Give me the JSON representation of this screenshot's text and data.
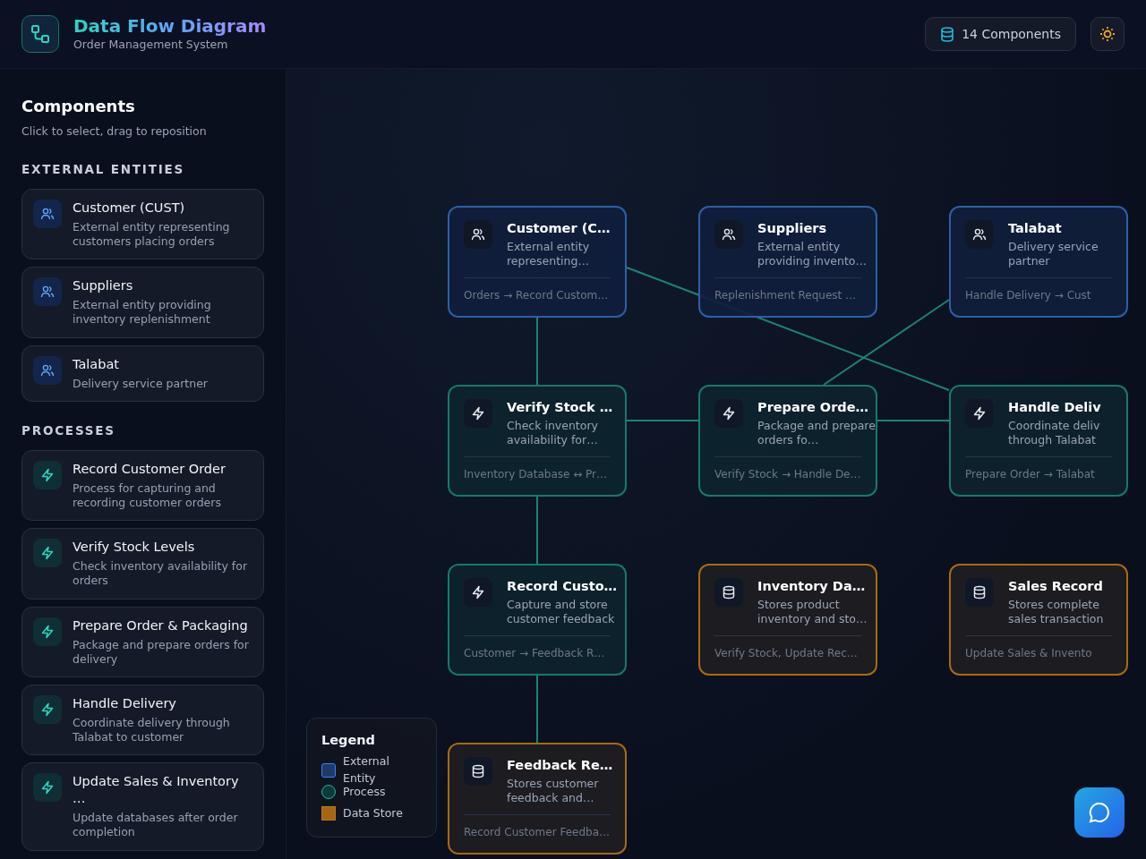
{
  "header": {
    "title": "Data Flow Diagram",
    "subtitle": "Order Management System",
    "component_count": "14 Components"
  },
  "sidebar": {
    "title": "Components",
    "hint": "Click to select, drag to reposition",
    "sections": [
      {
        "heading": "EXTERNAL ENTITIES",
        "kind": "external",
        "items": [
          {
            "title": "Customer (CUST)",
            "description": "External entity representing customers placing orders"
          },
          {
            "title": "Suppliers",
            "description": "External entity providing inventory replenishment"
          },
          {
            "title": "Talabat",
            "description": "Delivery service partner"
          }
        ]
      },
      {
        "heading": "PROCESSES",
        "kind": "process",
        "items": [
          {
            "title": "Record Customer Order",
            "description": "Process for capturing and recording customer orders"
          },
          {
            "title": "Verify Stock Levels",
            "description": "Check inventory availability for orders"
          },
          {
            "title": "Prepare Order & Packaging",
            "description": "Package and prepare orders for delivery"
          },
          {
            "title": "Handle Delivery",
            "description": "Coordinate delivery through Talabat to customer"
          },
          {
            "title": "Update Sales & Inventory …",
            "description": "Update databases after order completion"
          }
        ]
      }
    ]
  },
  "legend": {
    "title": "Legend",
    "items": [
      {
        "label": "External Entity",
        "kind": "external"
      },
      {
        "label": "Process",
        "kind": "process"
      },
      {
        "label": "Data Store",
        "kind": "store"
      }
    ]
  },
  "canvas": {
    "nodes": [
      {
        "kind": "external",
        "title": "Customer (C…",
        "description": "External entity representing…",
        "flows": "Orders → Record Custom…"
      },
      {
        "kind": "external",
        "title": "Suppliers",
        "description": "External entity providing invento…",
        "flows": "Replenishment Request …"
      },
      {
        "kind": "external",
        "title": "Talabat",
        "description": "Delivery service partner",
        "flows": "Handle Delivery → Cust"
      },
      {
        "kind": "process",
        "title": "Verify Stock …",
        "description": "Check inventory availability for…",
        "flows": "Inventory Database ↔ Pr…"
      },
      {
        "kind": "process",
        "title": "Prepare Orde…",
        "description": "Package and prepare orders fo…",
        "flows": "Verify Stock → Handle De…"
      },
      {
        "kind": "process",
        "title": "Handle Deliv",
        "description": "Coordinate deliv through Talabat",
        "flows": "Prepare Order → Talabat"
      },
      {
        "kind": "process",
        "title": "Record Custo…",
        "description": "Capture and store customer feedback",
        "flows": "Customer → Feedback R…"
      },
      {
        "kind": "store",
        "title": "Inventory Da…",
        "description": "Stores product inventory and sto…",
        "flows": "Verify Stock, Update Rec…"
      },
      {
        "kind": "store",
        "title": "Sales Record",
        "description": "Stores complete sales transaction",
        "flows": "Update Sales & Invento"
      },
      {
        "kind": "store",
        "title": "Feedback Re…",
        "description": "Stores customer feedback and…",
        "flows": "Record Customer Feedba…"
      }
    ]
  }
}
